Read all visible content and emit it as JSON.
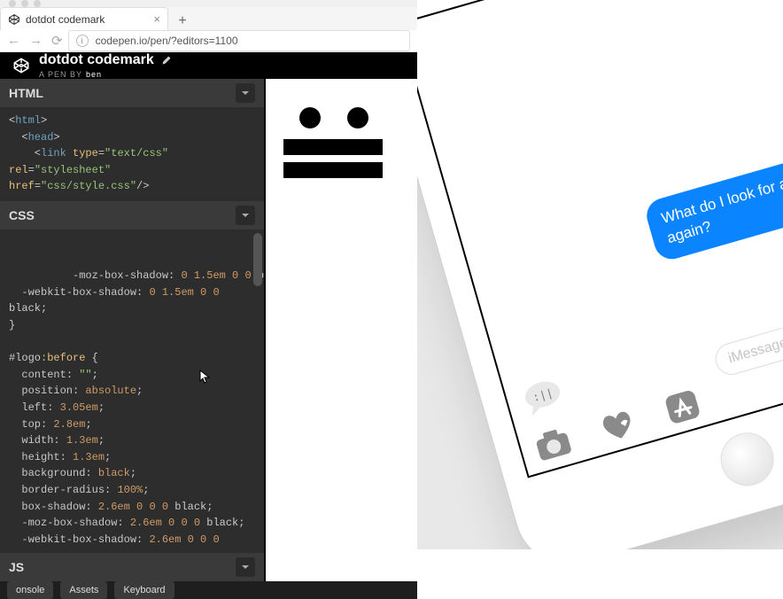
{
  "browser": {
    "tab_title": "dotdot codemark",
    "tab_close": "×",
    "new_tab": "+",
    "nav_back": "←",
    "nav_fwd": "→",
    "reload": "⟳",
    "url": "codepen.io/pen/?editors=1100"
  },
  "codepen": {
    "title": "dotdot codemark",
    "byline_prefix": "A PEN BY",
    "author": "ben",
    "panels": {
      "html_label": "HTML",
      "css_label": "CSS",
      "js_label": "JS"
    },
    "html_code": {
      "l1a": "<",
      "l1b": "html",
      "l1c": ">",
      "l2a": "  <",
      "l2b": "head",
      "l2c": ">",
      "l3a": "    <",
      "l3b": "link ",
      "l3c": "type",
      "l3d": "=",
      "l3e": "\"text/css\"",
      "l4a": "rel",
      "l4b": "=",
      "l4c": "\"stylesheet\"",
      "l5a": "href",
      "l5b": "=",
      "l5c": "\"css/style.css\"",
      "l5d": "/>"
    },
    "css_code": {
      "l1a": "  -moz-box-shadow",
      "l1b": ": ",
      "l1c": "0 1.5em 0 0 ",
      "l1d": "black",
      "l1e": ";",
      "l2a": "  -webkit-box-shadow",
      "l2b": ": ",
      "l2c": "0 1.5em 0 0",
      "l3a": "black",
      "l3b": ";",
      "l4a": "}",
      "l6a": "#logo",
      "l6b": ":before",
      "l6c": " {",
      "l7a": "  content",
      "l7b": ": ",
      "l7c": "\"\"",
      "l7d": ";",
      "l8a": "  position",
      "l8b": ": ",
      "l8c": "absolute",
      "l8d": ";",
      "l9a": "  left",
      "l9b": ": ",
      "l9c": "3.05em",
      "l9d": ";",
      "l10a": "  top",
      "l10b": ": ",
      "l10c": "2.8em",
      "l10d": ";",
      "l11a": "  width",
      "l11b": ": ",
      "l11c": "1.3em",
      "l11d": ";",
      "l12a": "  height",
      "l12b": ": ",
      "l12c": "1.3em",
      "l12d": ";",
      "l13a": "  background",
      "l13b": ": ",
      "l13c": "black",
      "l13d": ";",
      "l14a": "  border-radius",
      "l14b": ": ",
      "l14c": "100%",
      "l14d": ";",
      "l15a": "  box-shadow",
      "l15b": ": ",
      "l15c": "2.6em 0 0 0 ",
      "l15d": "black",
      "l15e": ";",
      "l16a": "  -moz-box-shadow",
      "l16b": ": ",
      "l16c": "2.6em 0 0 0 ",
      "l16d": "black",
      "l16e": ";",
      "l17a": "  -webkit-box-shadow",
      "l17b": ": ",
      "l17c": "2.6em 0 0 0"
    },
    "footer": {
      "console": "onsole",
      "assets": "Assets",
      "keyboard": "Keyboard"
    }
  },
  "phone": {
    "bubble": "What do I look for at Target again?",
    "placeholder": "iMessage"
  }
}
